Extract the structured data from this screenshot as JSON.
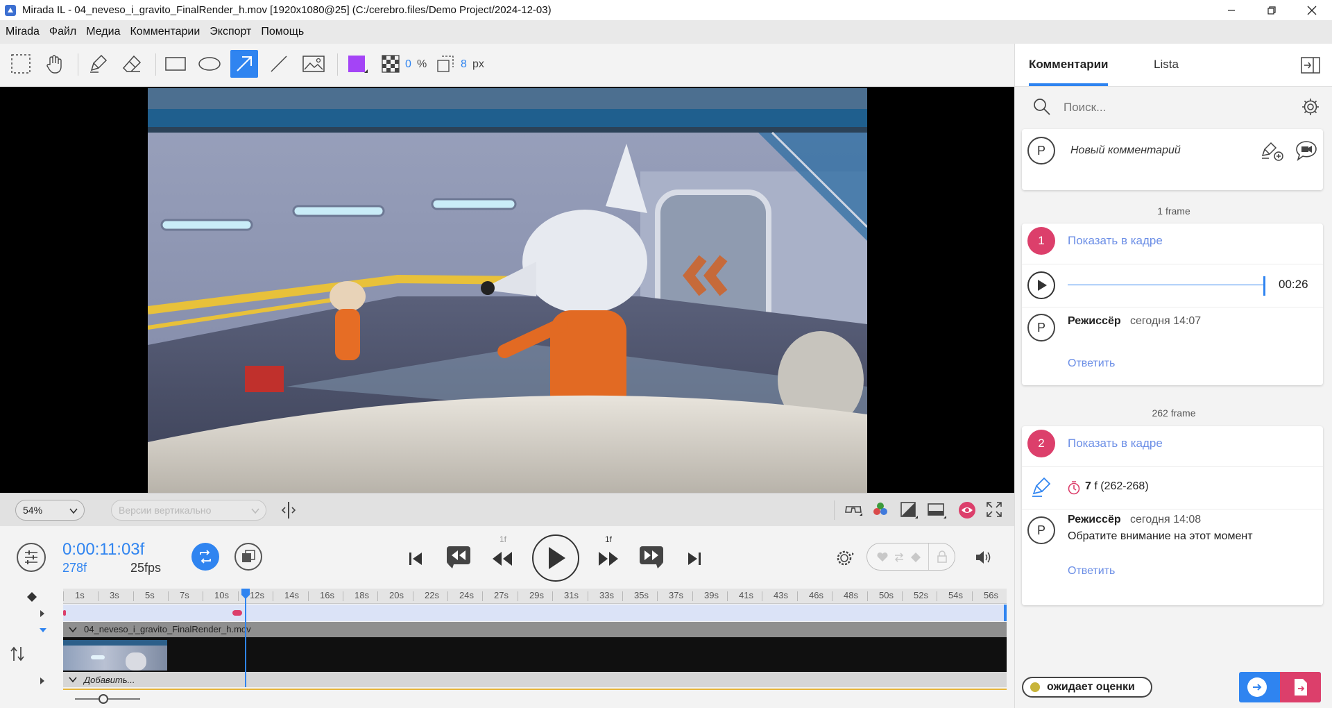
{
  "window": {
    "title": "Mirada IL - 04_neveso_i_gravito_FinalRender_h.mov [1920x1080@25] (C:/cerebro.files/Demo Project/2024-12-03)"
  },
  "menu": [
    "Mirada",
    "Файл",
    "Медиа",
    "Комментарии",
    "Экспорт",
    "Помощь"
  ],
  "toolbar": {
    "opacity_value": "0",
    "opacity_unit": "%",
    "stroke_value": "8",
    "stroke_unit": "px",
    "draw_color": "#a444f6",
    "active_tool": "arrow-tool"
  },
  "viewer_bar": {
    "zoom": "54%",
    "versions_placeholder": "Версии вертикально"
  },
  "transport": {
    "timecode": "0:00:11:03f",
    "frame": "278f",
    "fps": "25fps",
    "step_back_label": "1f",
    "step_forward_label": "1f"
  },
  "timeline": {
    "ticks": [
      "1s",
      "3s",
      "5s",
      "7s",
      "10s",
      "12s",
      "14s",
      "16s",
      "18s",
      "20s",
      "22s",
      "24s",
      "27s",
      "29s",
      "31s",
      "33s",
      "35s",
      "37s",
      "39s",
      "41s",
      "43s",
      "46s",
      "48s",
      "50s",
      "52s",
      "54s",
      "56s"
    ],
    "playhead_fraction": 0.193,
    "clip_name": "04_neveso_i_gravito_FinalRender_h.mov",
    "add_track_label": "Добавить..."
  },
  "panel": {
    "tabs": [
      "Комментарии",
      "Lista"
    ],
    "active_tab": 0,
    "search_placeholder": "Поиск...",
    "new_comment_placeholder": "Новый комментарий",
    "avatar_letter": "P",
    "groups": [
      {
        "frame_label": "1 frame",
        "number": "1",
        "show_in_frame": "Показать в кадре",
        "audio_time": "00:26",
        "author": "Режиссёр",
        "time": "сегодня 14:07",
        "text": "",
        "reply": "Ответить"
      },
      {
        "frame_label": "262 frame",
        "number": "2",
        "show_in_frame": "Показать в кадре",
        "duration_count": "7",
        "duration_unit": "f",
        "duration_range": "(262-268)",
        "author": "Режиссёр",
        "time": "сегодня 14:08",
        "text": "Обратите внимание на этот момент",
        "reply": "Ответить"
      }
    ],
    "status": "ожидает оценки",
    "status_color": "#c8b43a",
    "accent": "#2f84f0",
    "badge_color": "#dc3f6b"
  }
}
